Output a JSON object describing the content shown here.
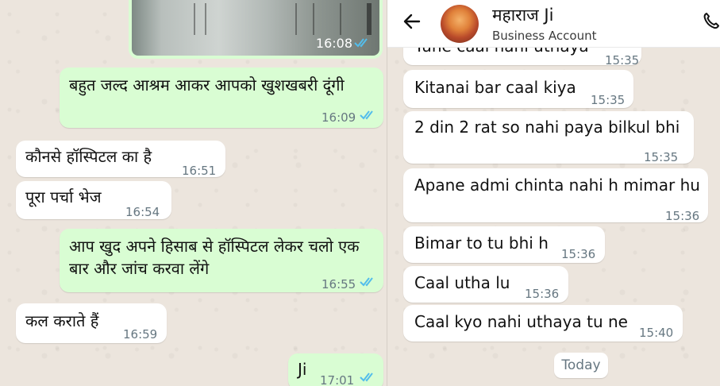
{
  "left_chat": {
    "image_message": {
      "time": "16:08"
    },
    "messages": [
      {
        "id": "m1",
        "dir": "out",
        "text": "बहुत जल्द आश्रम आकर आपको खुशखबरी दूंगी",
        "time": "16:09",
        "read": true
      },
      {
        "id": "m2",
        "dir": "in",
        "text": "कौनसे हॉस्पिटल का है",
        "time": "16:51"
      },
      {
        "id": "m3",
        "dir": "in",
        "text": "पूरा पर्चा भेज",
        "time": "16:54"
      },
      {
        "id": "m4",
        "dir": "out",
        "text": "आप खुद अपने हिसाब से हॉस्पिटल लेकर चलो एक बार और जांच करवा लेंगे",
        "time": "16:55",
        "read": true
      },
      {
        "id": "m5",
        "dir": "in",
        "text": "कल कराते हैं",
        "time": "16:59"
      },
      {
        "id": "m6",
        "dir": "out",
        "text": "Ji",
        "time": "17:01",
        "read": true
      }
    ]
  },
  "right_chat": {
    "header": {
      "contact_name": "महाराज Ji",
      "subtitle": "Business Account"
    },
    "partial_message": {
      "text": "Tune caal nahi uthaya",
      "time": "15:35"
    },
    "messages": [
      {
        "id": "r1",
        "text": "Kitanai bar caal kiya",
        "time": "15:35"
      },
      {
        "id": "r2",
        "text": "2 din 2 rat so nahi paya bilkul bhi",
        "time": "15:35"
      },
      {
        "id": "r3",
        "text": "Apane admi chinta nahi h mimar hu",
        "time": "15:36"
      },
      {
        "id": "r4",
        "text": "Bimar to tu bhi h",
        "time": "15:36"
      },
      {
        "id": "r5",
        "text": "Caal utha lu",
        "time": "15:36"
      },
      {
        "id": "r6",
        "text": "Caal kyo nahi uthaya tu ne",
        "time": "15:40"
      }
    ],
    "date_chip": "Today"
  },
  "icons": {
    "back": "back-arrow-icon",
    "call": "phone-icon",
    "read": "double-check-icon"
  },
  "colors": {
    "outgoing_bubble": "#d9fdd3",
    "incoming_bubble": "#ffffff",
    "read_ticks": "#53bdeb",
    "timestamp": "#667781",
    "background": "#ece5dd"
  }
}
